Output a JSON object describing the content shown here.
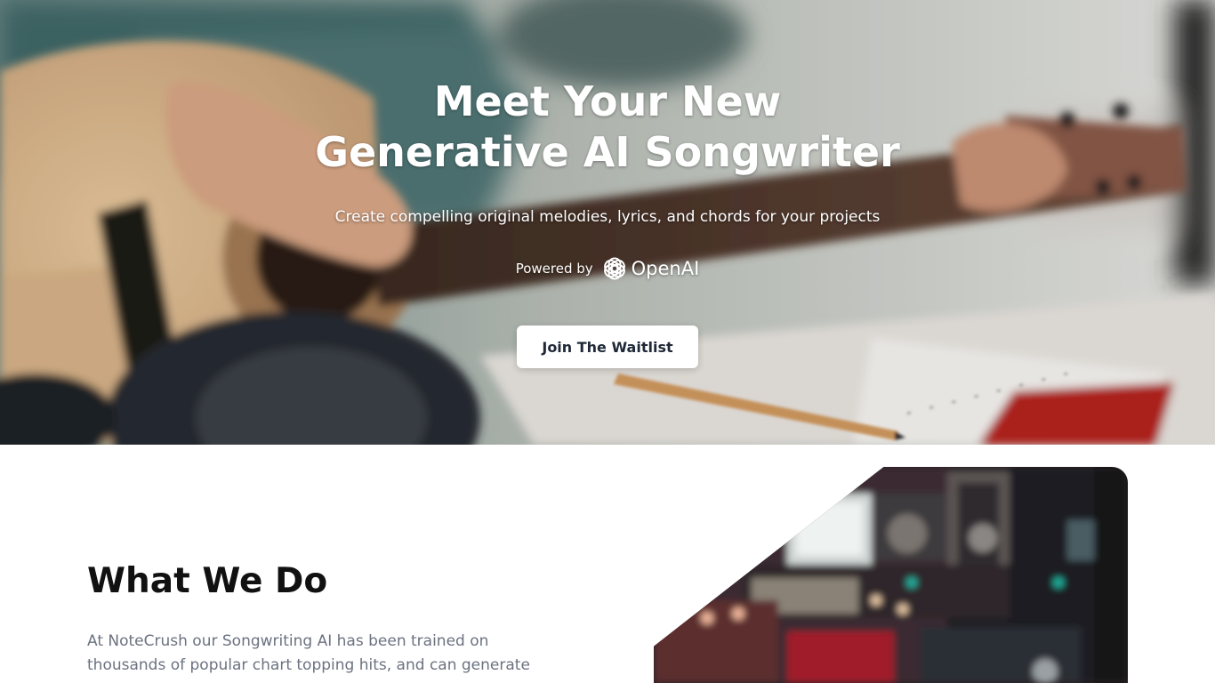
{
  "hero": {
    "title_line1": "Meet Your New",
    "title_line2": "Generative AI Songwriter",
    "subtitle": "Create compelling original melodies, lyrics, and chords for your projects",
    "powered_by_label": "Powered by",
    "partner_logo_text": "OpenAI",
    "cta_label": "Join The Waitlist"
  },
  "what_we_do": {
    "heading": "What We Do",
    "body": "At NoteCrush our Songwriting AI has been trained on thousands of popular chart topping hits, and can generate"
  },
  "icons": {
    "partner_logo": "openai-logo-icon"
  },
  "colors": {
    "cta_background": "#ffffff",
    "cta_text": "#1f2937",
    "heading_text": "#111111",
    "body_text": "#6b7280"
  }
}
